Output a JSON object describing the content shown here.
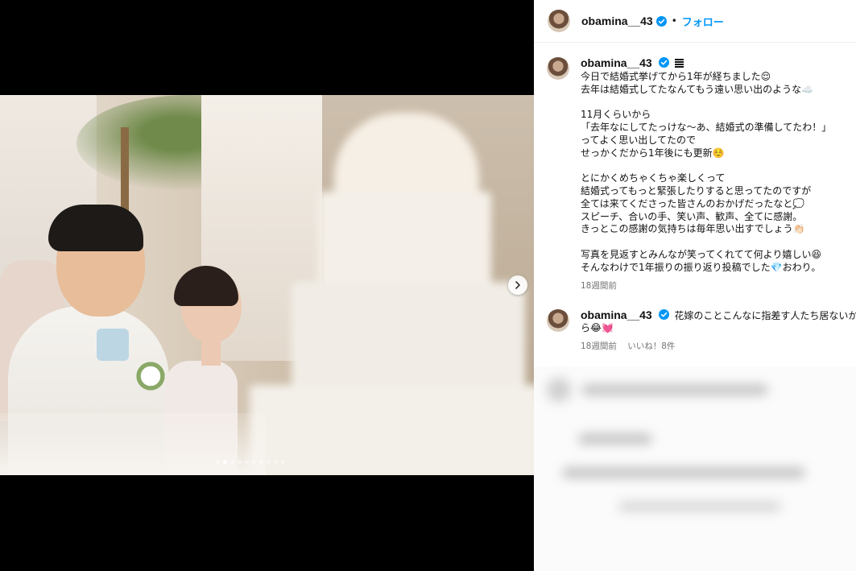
{
  "post": {
    "username": "obamina__43",
    "separator": "•",
    "follow_label": "フォロー",
    "photo_dot_count": 10,
    "photo_active_index": 1
  },
  "caption": {
    "username": "obamina__43",
    "lines": [
      "今日で結婚式挙げてから1年が経ちました😌",
      "去年は結婚式してたなんてもう遠い思い出のような☁️",
      "",
      "11月くらいから",
      "「去年なにしてたっけな〜あ、結婚式の準備してたわ！」",
      "ってよく思い出してたので",
      "せっかくだから1年後にも更新☺️",
      "",
      "とにかくめちゃくちゃ楽しくって",
      "結婚式ってもっと緊張したりすると思ってたのですが",
      "全ては来てくださった皆さんのおかげだったなと💭",
      "スピーチ、合いの手、笑い声、歓声、全てに感謝。",
      "きっとこの感謝の気持ちは毎年思い出すでしょう👏🏻",
      "",
      "写真を見返すとみんなが笑ってくれてて何より嬉しい😆",
      "そんなわけで1年振りの振り返り投稿でした💎おわり。"
    ],
    "time": "18週間前"
  },
  "comment": {
    "username": "obamina__43",
    "text_line1": "花嫁のことこんなに指差す人たち居ないか",
    "text_line2": "ら😂💓",
    "time": "18週間前",
    "likes": "いいね！8件"
  },
  "colors": {
    "accent": "#0095f6",
    "verified": "#0095f6",
    "meta": "#737373"
  },
  "icons": [
    "verified-badge-icon",
    "chevron-right-icon",
    "caption-flag-icon"
  ]
}
